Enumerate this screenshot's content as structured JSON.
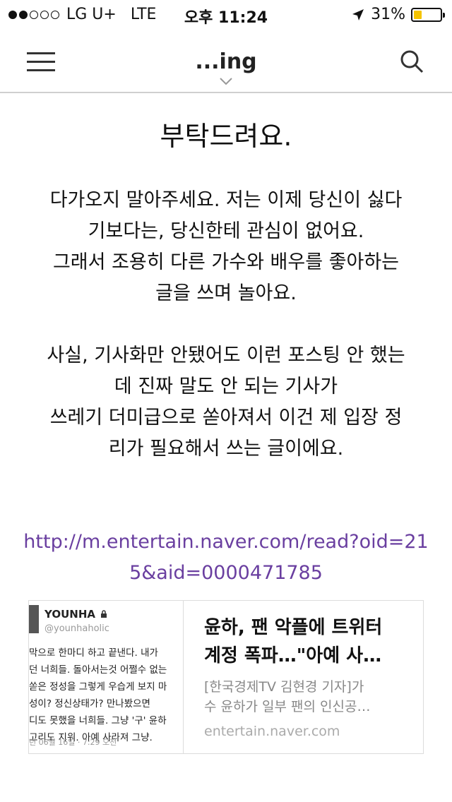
{
  "status_bar": {
    "carrier": "LG U+",
    "network": "LTE",
    "time": "오후 11:24",
    "battery_percent": "31%",
    "battery_level": 0.31,
    "battery_color": "#f4c400"
  },
  "nav": {
    "title": "...ing",
    "menu_icon": "hamburger-icon",
    "search_icon": "search-icon"
  },
  "article": {
    "title": "부탁드려요.",
    "para1": [
      "다가오지 말아주세요. 저는 이제 당신이 싫다",
      "기보다는, 당신한테 관심이 없어요.",
      "그래서 조용히 다른 가수와 배우를 좋아하는",
      "글을 쓰며 놀아요."
    ],
    "para2": [
      "사실, 기사화만 안됐어도 이런 포스팅 안 했는",
      "데 진짜 말도 안 되는 기사가",
      "쓰레기 더미급으로 쏟아져서 이건 제 입장 정",
      "리가 필요해서 쓰는 글이에요."
    ],
    "link_lines": [
      "http://m.entertain.naver.com/read?oid=21",
      "5&aid=0000471785"
    ],
    "link_color": "#6a3fa0"
  },
  "preview_card": {
    "thumb": {
      "name": "YOUNHA",
      "handle": "@younhaholic",
      "lines": [
        "막으로 한마디 하고 끝낸다. 내가",
        "던 너희들. 돌아서는것 어쩔수 없는",
        "쏟은 정성을 그렇게 우습게 보지 마",
        "성이? 정신상태가? 만나봤으면",
        "디도 못했을 너희들. 그냥 '구' 윤하",
        "고리도 지워. 아예 사라져 그냥."
      ],
      "date": "년 06월 16일 · 7:29 오전"
    },
    "headline_lines": [
      "윤하, 팬 악플에 트위터",
      "계정 폭파…\"아예 사…"
    ],
    "desc_lines": [
      "[한국경제TV 김현경 기자]가",
      "수 윤하가 일부 팬의 인신공…"
    ],
    "domain": "entertain.naver.com"
  }
}
